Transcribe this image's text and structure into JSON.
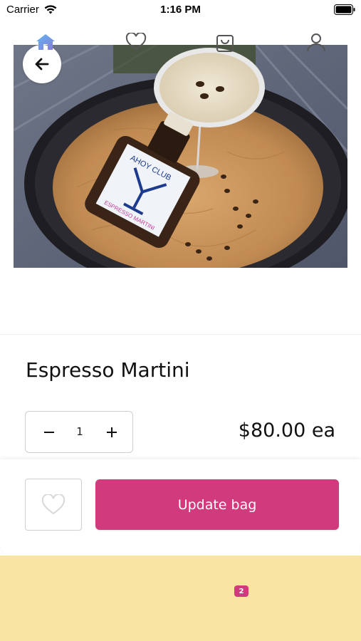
{
  "status_bar": {
    "carrier": "Carrier",
    "time": "1:16 PM"
  },
  "product": {
    "title": "Espresso Martini",
    "price": "$80.00 ea",
    "image_alt": "Espresso Martini bottle and cocktail glass on a barrel"
  },
  "quantity": {
    "value": "1"
  },
  "actions": {
    "update_label": "Update bag"
  },
  "tab_bar": {
    "bag_badge": "2",
    "active_tab": "home"
  },
  "colors": {
    "accent": "#d23a7e",
    "tab_bar_bg": "#f9e4a3",
    "home_icon": "#57a8e8"
  },
  "icons": [
    "arrow-left-icon",
    "minus-icon",
    "plus-icon",
    "heart-icon",
    "home-icon",
    "shopping-bag-icon",
    "user-icon",
    "wifi-icon",
    "battery-icon"
  ]
}
